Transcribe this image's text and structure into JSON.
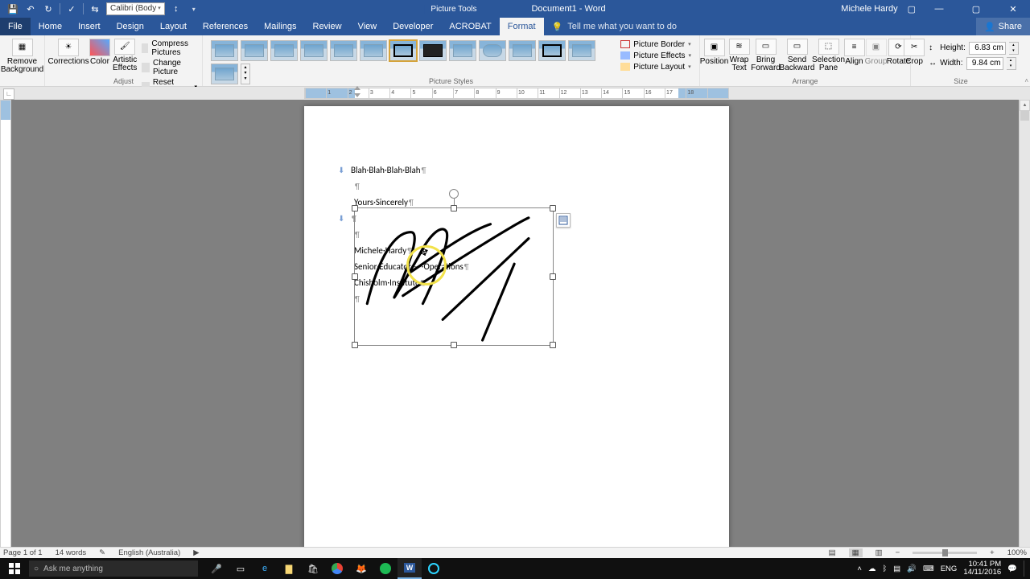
{
  "title": {
    "tools_tab": "Picture Tools",
    "document": "Document1 - Word",
    "user": "Michele Hardy"
  },
  "qat": {
    "font": "Calibri (Body"
  },
  "tabs": {
    "file": "File",
    "home": "Home",
    "insert": "Insert",
    "design": "Design",
    "layout": "Layout",
    "references": "References",
    "mailings": "Mailings",
    "review": "Review",
    "view": "View",
    "developer": "Developer",
    "acrobat": "ACROBAT",
    "format": "Format",
    "tellme": "Tell me what you want to do",
    "share": "Share"
  },
  "ribbon": {
    "remove_bg": "Remove Background",
    "corrections": "Corrections",
    "color": "Color",
    "artistic": "Artistic Effects",
    "compress": "Compress Pictures",
    "change": "Change Picture",
    "reset": "Reset Picture",
    "adjust": "Adjust",
    "picture_styles": "Picture Styles",
    "border": "Picture Border",
    "effects": "Picture Effects",
    "layout": "Picture Layout",
    "position": "Position",
    "wrap": "Wrap Text",
    "forward": "Bring Forward",
    "backward": "Send Backward",
    "selection": "Selection Pane",
    "align": "Align",
    "group": "Group",
    "rotate": "Rotate",
    "arrange": "Arrange",
    "crop": "Crop",
    "height_lbl": "Height:",
    "width_lbl": "Width:",
    "height": "6.83 cm",
    "width": "9.84 cm",
    "size": "Size"
  },
  "document": {
    "line1": "Blah·Blah·Blah·Blah",
    "line2": "Yours·Sincerely",
    "line3": "Michele·Hardy",
    "line4": "Senior·Educator·—·Operations",
    "line5": "Chisholm·Institute"
  },
  "status": {
    "page": "Page 1 of 1",
    "words": "14 words",
    "lang": "English (Australia)",
    "zoom": "100%"
  },
  "taskbar": {
    "search_placeholder": "Ask me anything",
    "lang": "ENG",
    "time": "10:41 PM",
    "date": "14/11/2016"
  }
}
